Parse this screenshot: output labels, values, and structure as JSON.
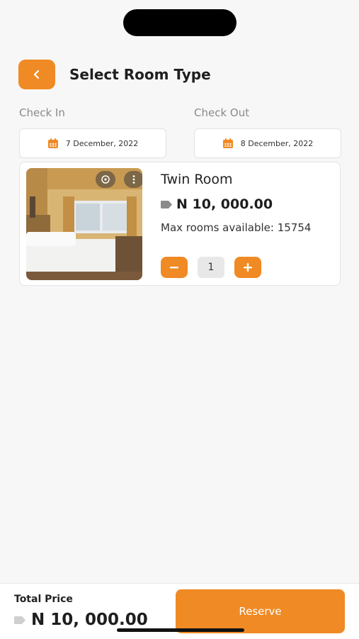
{
  "header": {
    "title": "Select Room Type"
  },
  "check_in": {
    "label": "Check In",
    "date": "7 December, 2022"
  },
  "check_out": {
    "label": "Check Out",
    "date": "8 December, 2022"
  },
  "room": {
    "name": "Twin Room",
    "price": "N 10, 000.00",
    "availability": "Max rooms available: 15754",
    "quantity": "1"
  },
  "footer": {
    "total_label": "Total Price",
    "total_price": "N 10, 000.00",
    "reserve_label": "Reserve"
  },
  "colors": {
    "accent": "#f08a24",
    "background": "#f7f7f7"
  }
}
